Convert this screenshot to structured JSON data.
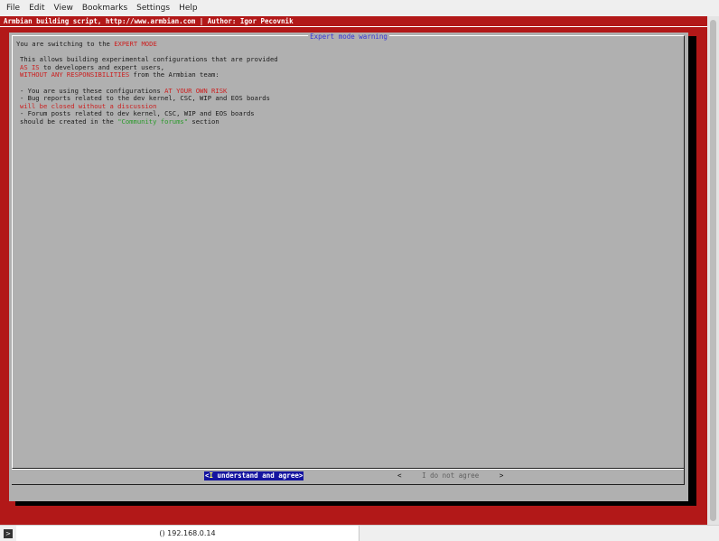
{
  "menubar": {
    "items": [
      "File",
      "Edit",
      "View",
      "Bookmarks",
      "Settings",
      "Help"
    ]
  },
  "terminal": {
    "title": "Armbian building script, http://www.armbian.com | Author: Igor Pecovnik"
  },
  "dialog": {
    "title": "Expert mode warning",
    "lines": [
      {
        "segments": [
          {
            "t": "You are switching to the ",
            "c": ""
          },
          {
            "t": "EXPERT MODE",
            "c": "red"
          }
        ]
      },
      {
        "segments": [
          {
            "t": "",
            "c": ""
          }
        ]
      },
      {
        "segments": [
          {
            "t": "This allows building experimental configurations that are provided",
            "c": ""
          }
        ]
      },
      {
        "segments": [
          {
            "t": "AS IS",
            "c": "red"
          },
          {
            "t": " to developers and expert users,",
            "c": ""
          }
        ]
      },
      {
        "segments": [
          {
            "t": "WITHOUT ANY RESPONSIBILITIES",
            "c": "red"
          },
          {
            "t": " from the Armbian team:",
            "c": ""
          }
        ]
      },
      {
        "segments": [
          {
            "t": "",
            "c": ""
          }
        ]
      },
      {
        "segments": [
          {
            "t": "- You are using these configurations ",
            "c": ""
          },
          {
            "t": "AT YOUR OWN RISK",
            "c": "red"
          }
        ]
      },
      {
        "segments": [
          {
            "t": "- Bug reports related to the dev kernel, CSC, WIP and EOS boards",
            "c": ""
          }
        ]
      },
      {
        "segments": [
          {
            "t": "will be closed without a discussion",
            "c": "red"
          }
        ]
      },
      {
        "segments": [
          {
            "t": "- Forum posts related to dev kernel, CSC, WIP and EOS boards",
            "c": ""
          }
        ]
      },
      {
        "segments": [
          {
            "t": "should be created in the ",
            "c": ""
          },
          {
            "t": "\"Community forums\"",
            "c": "green"
          },
          {
            "t": " section",
            "c": ""
          }
        ]
      }
    ],
    "buttons": {
      "agree_open": "<",
      "agree_hot": "I",
      "agree_rest": " understand and agree",
      "agree_close": ">",
      "disagree_open": "<",
      "disagree_label": "I do not agree",
      "disagree_close": ">"
    }
  },
  "statusbar": {
    "tab_label": "() 192.168.0.14",
    "prompt_icon": ">"
  },
  "colors": {
    "terminal_bg": "#b21818",
    "dialog_bg": "#b0b0b0",
    "title_blue": "#3535d8",
    "highlight_red": "#cc2020",
    "highlight_green": "#2a9a2a",
    "button_selected_bg": "#1414a0"
  }
}
